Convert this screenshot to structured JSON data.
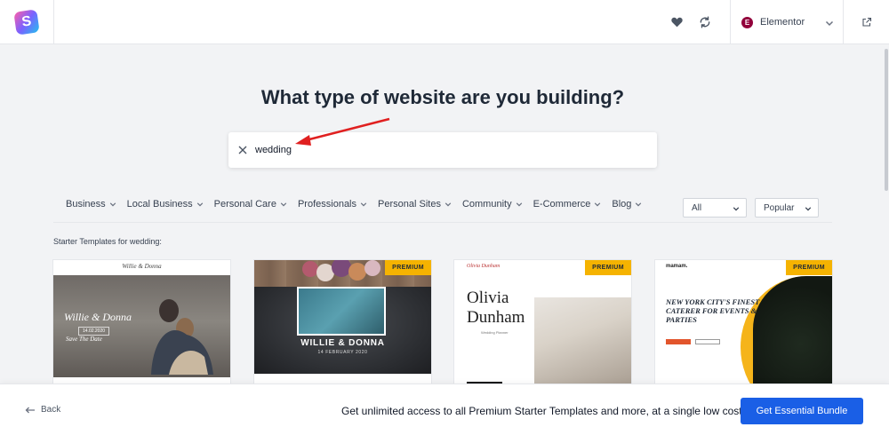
{
  "header": {
    "logo_letter": "S",
    "builder_badge": "E",
    "builder_label": "Elementor",
    "icons": {
      "favorites": "heart-icon",
      "sync": "sync-icon",
      "open_external": "external-link-icon",
      "dropdown": "chevron-down-icon"
    }
  },
  "main": {
    "title": "What type of website are you building?",
    "search": {
      "value": "wedding"
    },
    "categories": [
      {
        "label": "Business"
      },
      {
        "label": "Local Business"
      },
      {
        "label": "Personal Care"
      },
      {
        "label": "Professionals"
      },
      {
        "label": "Personal Sites"
      },
      {
        "label": "Community"
      },
      {
        "label": "E-Commerce"
      },
      {
        "label": "Blog"
      }
    ],
    "type_filter": "All",
    "sort_filter": "Popular",
    "results_label": "Starter Templates for wedding:"
  },
  "cards": [
    {
      "premium": false,
      "logo": "Willie & Donna",
      "names": "Willie & Donna",
      "date": "14.02.2020",
      "tagline": "Save The Date"
    },
    {
      "premium": true,
      "badge": "PREMIUM",
      "names": "WILLIE & DONNA",
      "date": "14 FEBRUARY 2020"
    },
    {
      "premium": true,
      "badge": "PREMIUM",
      "logo": "Olivia Dunham",
      "title_line1": "Olivia",
      "title_line2": "Dunham",
      "sub": "Wedding Planner"
    },
    {
      "premium": true,
      "badge": "PREMIUM",
      "logo": "mamam.",
      "headline": "NEW YORK CITY'S FINEST CATERER FOR EVENTS & PARTIES"
    }
  ],
  "footer": {
    "back_label": "Back",
    "promo": "Get unlimited access to all Premium Starter Templates and more, at a single low cost!",
    "cta_label": "Get Essential Bundle"
  },
  "colors": {
    "accent": "#1a5fe6",
    "premium": "#f5b301",
    "annotation_arrow": "#e02020"
  }
}
